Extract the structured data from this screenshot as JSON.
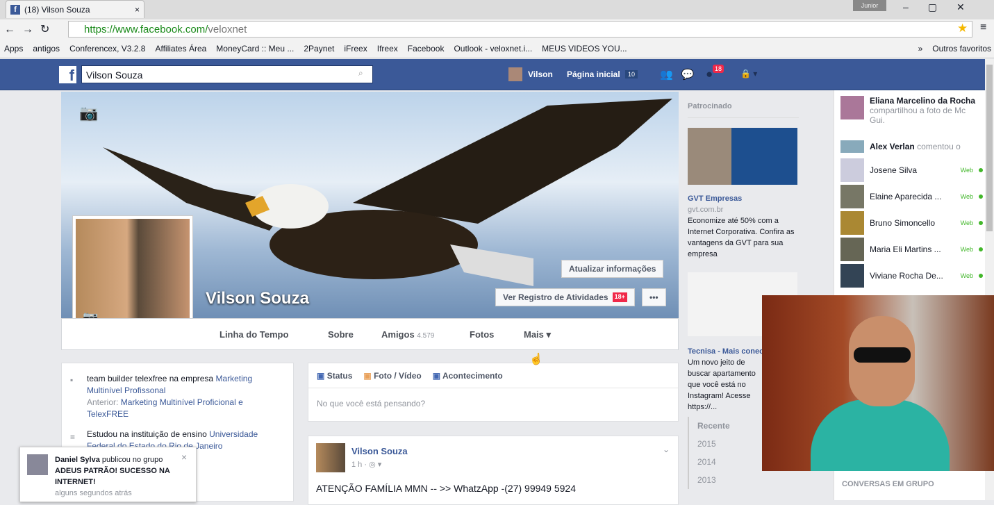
{
  "browser": {
    "tab_title": "(18) Vilson Souza",
    "url_prefix": "https://www.facebook.com/",
    "url_path": "veloxnet",
    "user": "Junior",
    "bookmarks": [
      "Apps",
      "antigos",
      "Conferencex, V3.2.8",
      "Affiliates Área",
      "MoneyCard :: Meu ...",
      "2Paynet",
      "iFreex",
      "Ifreex",
      "Facebook",
      "Outlook - veloxnet.i...",
      "MEUS VIDEOS YOU...",
      "»",
      "Outros favoritos"
    ]
  },
  "fb": {
    "search_value": "Vilson Souza",
    "user_name": "Vilson",
    "home": "Página inicial",
    "home_count": "10",
    "notif_count": "18"
  },
  "profile": {
    "name": "Vilson Souza",
    "update_info": "Atualizar informações",
    "activity_log": "Ver Registro de Atividades",
    "activity_badge": "18+",
    "more": "•••",
    "tabs": {
      "timeline": "Linha do Tempo",
      "about": "Sobre",
      "friends": "Amigos",
      "friends_count": "4.579",
      "photos": "Fotos",
      "more": "Mais ▾"
    }
  },
  "intro": {
    "work": "team builder telexfree na empresa",
    "work_link": "Marketing Multinível Profissonal",
    "previous_label": "Anterior:",
    "previous": "Marketing Multinível Proficional e TelexFREE",
    "study": "Estudou na instituição de ensino",
    "study_link": "Universidade Federal do Estado do Rio de Janeiro"
  },
  "composer": {
    "status": "Status",
    "photo": "Foto / Vídeo",
    "event": "Acontecimento",
    "placeholder": "No que você está pensando?"
  },
  "post": {
    "author": "Vilson Souza",
    "time": "1 h · ◎ ▾",
    "text": "ATENÇÃO FAMÍLIA MMN -- >> WhatzApp -(27) 99949 5924"
  },
  "ads": {
    "header": "Patrocinado",
    "ad1_title": "GVT Empresas",
    "ad1_url": "gvt.com.br",
    "ad1_text": "Economize até 50% com a Internet Corporativa. Confira as vantagens da GVT para sua empresa",
    "ad2_title": "Tecnisa - Mais conectada",
    "ad2_text": "Um novo jeito de buscar apartamento que você está no Instagram! Acesse https://..."
  },
  "years": [
    "Recente",
    "2015",
    "2014",
    "2013"
  ],
  "ticker": [
    {
      "name": "Eliana Marcelino da Rocha",
      "action": "compartilhou a foto de Mc Gui."
    },
    {
      "name": "Alex Verlan",
      "action": "comentou o"
    }
  ],
  "chat": {
    "status": "Web",
    "contacts": [
      "Josene Silva",
      "Elaine Aparecida ...",
      "Bruno Simoncello",
      "Maria Eli Martins ...",
      "Viviane Rocha De..."
    ],
    "group_header": "CONVERSAS EM GRUPO"
  },
  "notification": {
    "name": "Daniel Sylva",
    "text1": "publicou no grupo",
    "group": "ADEUS PATRÃO! SUCESSO NA INTERNET!",
    "time": "alguns segundos atrás"
  }
}
